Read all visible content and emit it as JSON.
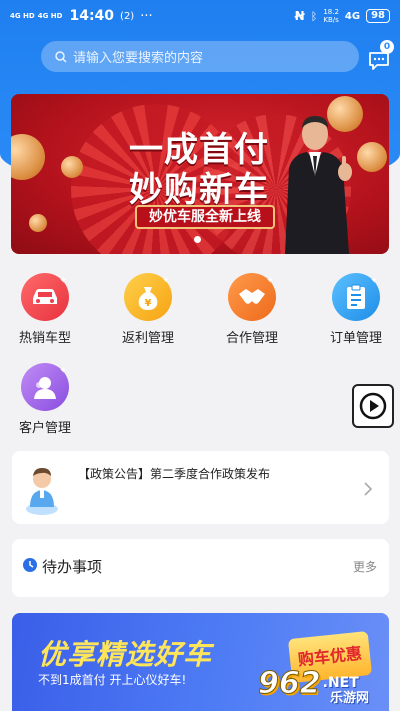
{
  "statusbar": {
    "signal1": "4G HD",
    "signal2": "4G HD",
    "time": "14:40",
    "badge": "(2)",
    "dots": "···",
    "speed_value": "18.2",
    "speed_unit": "KB/s",
    "network": "4G",
    "battery": "98"
  },
  "search": {
    "placeholder": "请输入您要搜索的内容"
  },
  "messages": {
    "count": "0"
  },
  "banner": {
    "line1": "一成首付",
    "line2": "妙购新车",
    "tag": "妙优车服全新上线"
  },
  "grid": [
    {
      "label": "热销车型",
      "color": "#ee3f4d",
      "icon": "car-icon"
    },
    {
      "label": "返利管理",
      "color": "#f9b21b",
      "icon": "money-bag-icon"
    },
    {
      "label": "合作管理",
      "color": "#f47b26",
      "icon": "handshake-icon"
    },
    {
      "label": "订单管理",
      "color": "#2fa3f0",
      "icon": "clipboard-icon"
    },
    {
      "label": "客户管理",
      "color": "#9b5de5",
      "icon": "customer-icon"
    }
  ],
  "notice": {
    "text": "【政策公告】第二季度合作政策发布"
  },
  "todo": {
    "title": "待办事项",
    "more": "更多"
  },
  "promo": {
    "title": "优享精选好车",
    "subtitle": "不到1成首付 开上心仪好车!",
    "badge": "购车优惠"
  },
  "watermark": {
    "num": "962",
    "net": ".NET",
    "cn": "乐游网"
  },
  "colors": {
    "primary": "#2b8cf7",
    "banner_red": "#c41a24"
  }
}
